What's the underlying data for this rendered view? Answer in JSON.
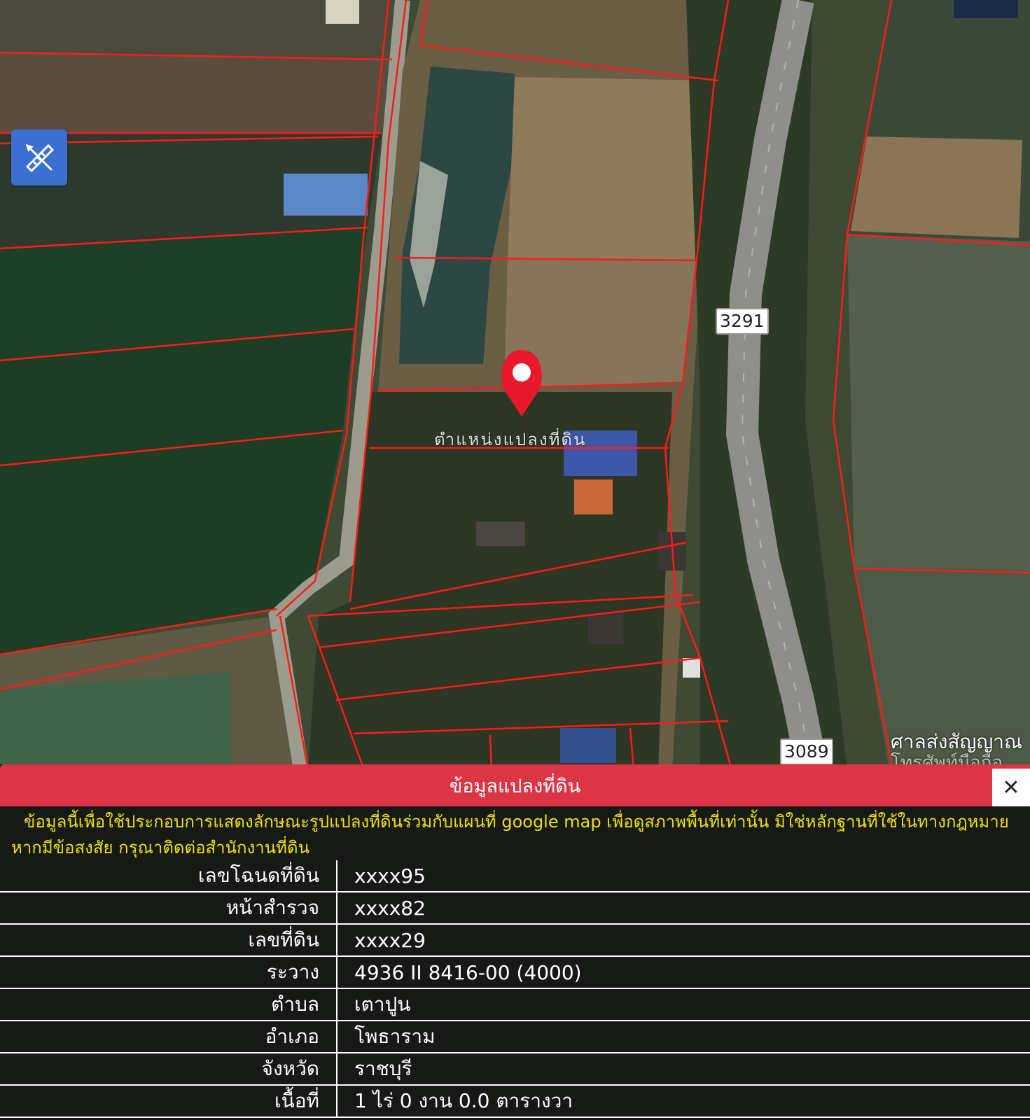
{
  "map": {
    "road_labels": [
      "3291",
      "3089"
    ],
    "marker_label": "ตำแหน่งแปลงที่ดิน",
    "corner_text": [
      "ศาลส่งสัญญาณ",
      "โทรศัพท์มือถือ"
    ],
    "marker_color": "#e8192c",
    "parcel_line_color": "#ff1a1a",
    "tool_icon": "ruler-pencil-icon"
  },
  "panel": {
    "title": "ข้อมูลแปลงที่ดิน",
    "close_label": "✕",
    "notice": "ข้อมูลนี้เพื่อใช้ประกอบการแสดงลักษณะรูปแปลงที่ดินร่วมกับแผนที่ google map เพื่อดูสภาพพื้นที่เท่านั้น มิใช่หลักฐานที่ใช้ในทางกฎหมาย หากมีข้อสงสัย กรุณาติดต่อสำนักงานที่ดิน",
    "header_color": "#dc3545",
    "notice_color": "#e9e300",
    "rows": [
      {
        "label": "เลขโฉนดที่ดิน",
        "value": "xxxx95"
      },
      {
        "label": "หน้าสำรวจ",
        "value": "xxxx82"
      },
      {
        "label": "เลขที่ดิน",
        "value": "xxxx29"
      },
      {
        "label": "ระวาง",
        "value": "4936 II 8416-00 (4000)"
      },
      {
        "label": "ตำบล",
        "value": "เตาปูน"
      },
      {
        "label": "อำเภอ",
        "value": "โพธาราม"
      },
      {
        "label": "จังหวัด",
        "value": "ราชบุรี"
      },
      {
        "label": "เนื้อที่",
        "value": "1 ไร่ 0 งาน 0.0 ตารางวา"
      }
    ]
  }
}
